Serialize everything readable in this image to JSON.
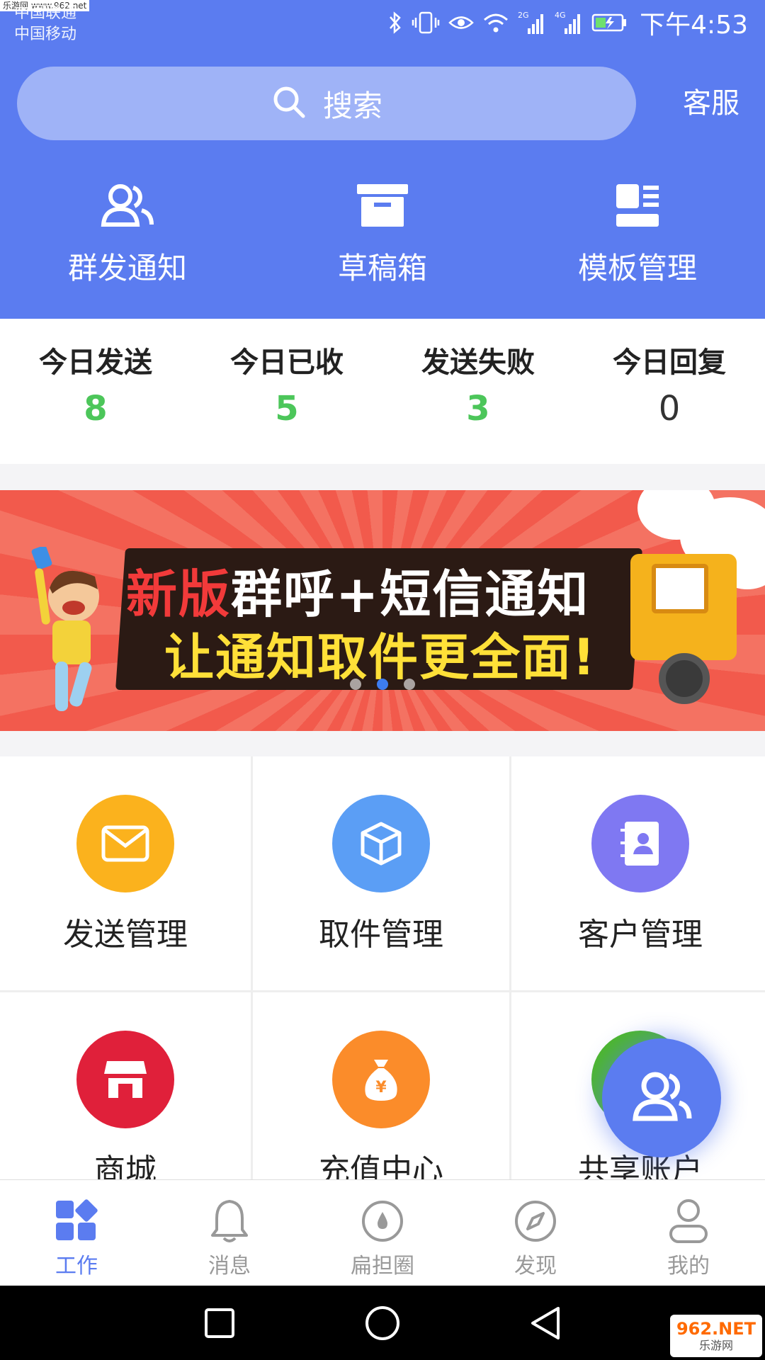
{
  "status_bar": {
    "carrier_1": "中国联通",
    "carrier_2": "中国移动",
    "net_2g": "2G",
    "net_4g": "4G",
    "time": "下午4:53",
    "watermark": "乐游网 www.962.net"
  },
  "search": {
    "placeholder": "搜索"
  },
  "header": {
    "service_label": "客服"
  },
  "quick_actions": [
    {
      "label": "群发通知",
      "icon": "group-icon"
    },
    {
      "label": "草稿箱",
      "icon": "box-icon"
    },
    {
      "label": "模板管理",
      "icon": "template-icon"
    }
  ],
  "stats": [
    {
      "label": "今日发送",
      "value": "8"
    },
    {
      "label": "今日已收",
      "value": "5"
    },
    {
      "label": "发送失败",
      "value": "3"
    },
    {
      "label": "今日回复",
      "value": "0"
    }
  ],
  "banner": {
    "title_red": "新版",
    "title_white": "群呼+短信通知",
    "subtitle": "让通知取件更全面!",
    "page_index": 2,
    "page_count": 3
  },
  "grid": [
    {
      "label": "发送管理",
      "icon": "mail-icon",
      "color": "#fbb21d"
    },
    {
      "label": "取件管理",
      "icon": "package-icon",
      "color": "#5b9ef5"
    },
    {
      "label": "客户管理",
      "icon": "contacts-icon",
      "color": "#7f78f2"
    },
    {
      "label": "商城",
      "icon": "shop-icon",
      "color": "#e0203a"
    },
    {
      "label": "充值中心",
      "icon": "money-bag-icon",
      "color": "#fb8c2a"
    },
    {
      "label": "共享账户",
      "icon": "shared-account-icon",
      "color": "#4cb82a"
    }
  ],
  "tabs": [
    {
      "label": "工作",
      "icon": "grid-icon",
      "active": true
    },
    {
      "label": "消息",
      "icon": "bell-icon",
      "active": false
    },
    {
      "label": "扁担圈",
      "icon": "drop-circle-icon",
      "active": false
    },
    {
      "label": "发现",
      "icon": "compass-icon",
      "active": false
    },
    {
      "label": "我的",
      "icon": "user-icon",
      "active": false
    }
  ],
  "colors": {
    "primary": "#5b7cf0",
    "stat_green": "#4cc65a"
  },
  "watermark": {
    "brand": "962.NET",
    "name": "乐游网"
  }
}
